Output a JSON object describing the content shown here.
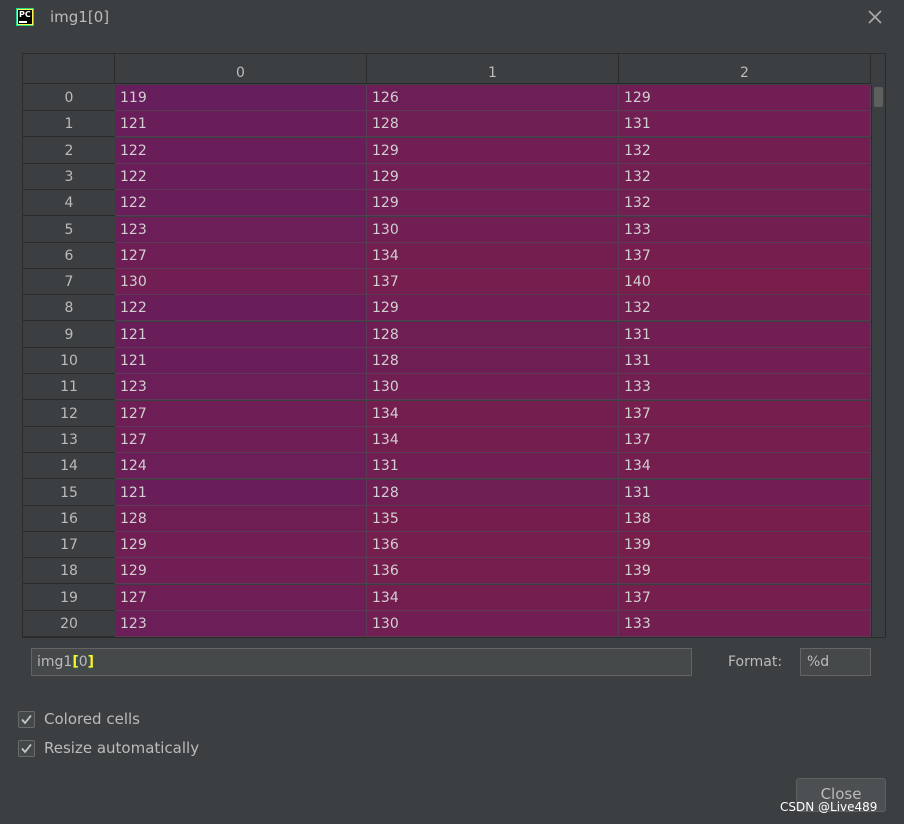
{
  "window": {
    "title": "img1[0]",
    "close_icon": "close-icon",
    "app_icon": "pycharm-icon",
    "app_icon_text": "PC"
  },
  "table": {
    "columns": [
      "0",
      "1",
      "2"
    ],
    "row_labels": [
      "0",
      "1",
      "2",
      "3",
      "4",
      "5",
      "6",
      "7",
      "8",
      "9",
      "10",
      "11",
      "12",
      "13",
      "14",
      "15",
      "16",
      "17",
      "18",
      "19",
      "20"
    ],
    "rows": [
      [
        119,
        126,
        129
      ],
      [
        121,
        128,
        131
      ],
      [
        122,
        129,
        132
      ],
      [
        122,
        129,
        132
      ],
      [
        122,
        129,
        132
      ],
      [
        123,
        130,
        133
      ],
      [
        127,
        134,
        137
      ],
      [
        130,
        137,
        140
      ],
      [
        122,
        129,
        132
      ],
      [
        121,
        128,
        131
      ],
      [
        121,
        128,
        131
      ],
      [
        123,
        130,
        133
      ],
      [
        127,
        134,
        137
      ],
      [
        127,
        134,
        137
      ],
      [
        124,
        131,
        134
      ],
      [
        121,
        128,
        131
      ],
      [
        128,
        135,
        138
      ],
      [
        129,
        136,
        139
      ],
      [
        129,
        136,
        139
      ],
      [
        127,
        134,
        137
      ],
      [
        123,
        130,
        133
      ]
    ],
    "colors": {
      "cell_purple": "#6b1f55",
      "cell_magenta": "#731e4e",
      "cell_text": "#d0d0d0"
    }
  },
  "slice": {
    "name": "img1",
    "open_bracket": "[",
    "index": "0",
    "close_bracket": "]"
  },
  "format": {
    "label": "Format:",
    "value": "%d"
  },
  "options": {
    "colored_cells": {
      "label": "Colored cells",
      "checked": true
    },
    "resize_auto": {
      "label": "Resize automatically",
      "checked": true
    }
  },
  "buttons": {
    "close": "Close"
  },
  "watermark": "CSDN @Live489"
}
